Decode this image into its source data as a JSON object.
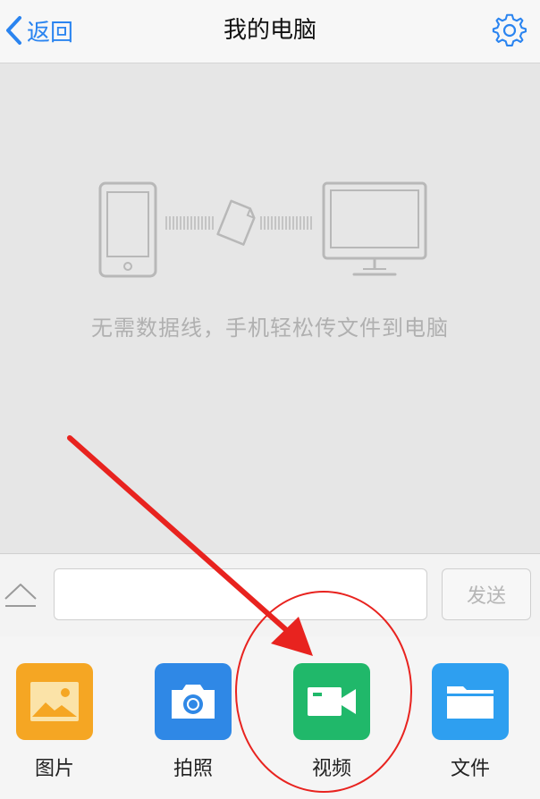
{
  "navbar": {
    "back_label": "返回",
    "title": "我的电脑",
    "settings_icon": "gear-icon"
  },
  "main": {
    "illustration": [
      "phone-icon",
      "document-icon",
      "monitor-icon"
    ],
    "hint": "无需数据线，手机轻松传文件到电脑"
  },
  "input_bar": {
    "expand_icon": "chevron-up-icon",
    "message_value": "",
    "send_label": "发送"
  },
  "toolbar": {
    "items": [
      {
        "label": "图片",
        "icon": "image-icon",
        "color": "#f5a623"
      },
      {
        "label": "拍照",
        "icon": "camera-icon",
        "color": "#2f88e6"
      },
      {
        "label": "视频",
        "icon": "video-camera-icon",
        "color": "#20b86a"
      },
      {
        "label": "文件",
        "icon": "folder-icon",
        "color": "#2e9ff0"
      }
    ]
  },
  "annotation": {
    "arrow_color": "#e8231f",
    "circle_color": "#e8231f",
    "highlighted_item": "视频"
  },
  "colors": {
    "accent": "#2a84f0",
    "background": "#e6e6e6"
  }
}
